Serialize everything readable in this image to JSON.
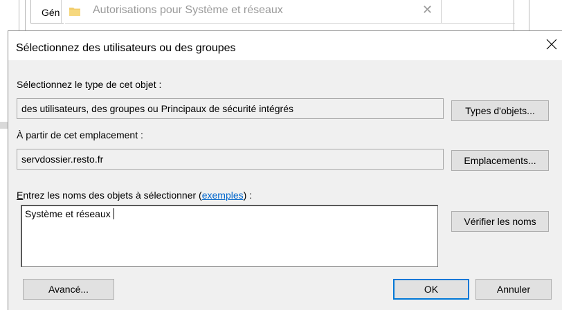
{
  "background_window": {
    "tab_label": "Gén",
    "title": "Autorisations pour Système et réseaux"
  },
  "dialog": {
    "title": "Sélectionnez des utilisateurs ou des groupes",
    "object_type_label": "Sélectionnez le type de cet objet :",
    "object_type_value": "des utilisateurs, des groupes ou Principaux de sécurité intégrés",
    "object_types_button": "Types d'objets...",
    "location_label": "À partir de cet emplacement :",
    "location_value": "servdossier.resto.fr",
    "locations_button": "Emplacements...",
    "names_label_first": "E",
    "names_label_rest": "ntrez les noms des objets à sélectionner (",
    "names_label_link": "exemples",
    "names_label_end": ") :",
    "names_value": "Système et réseaux",
    "check_names_button": "Vérifier les noms",
    "advanced_button": "Avancé...",
    "ok_button": "OK",
    "cancel_button": "Annuler"
  },
  "colors": {
    "default_button_border": "#0078d7",
    "link": "#0066cc"
  }
}
